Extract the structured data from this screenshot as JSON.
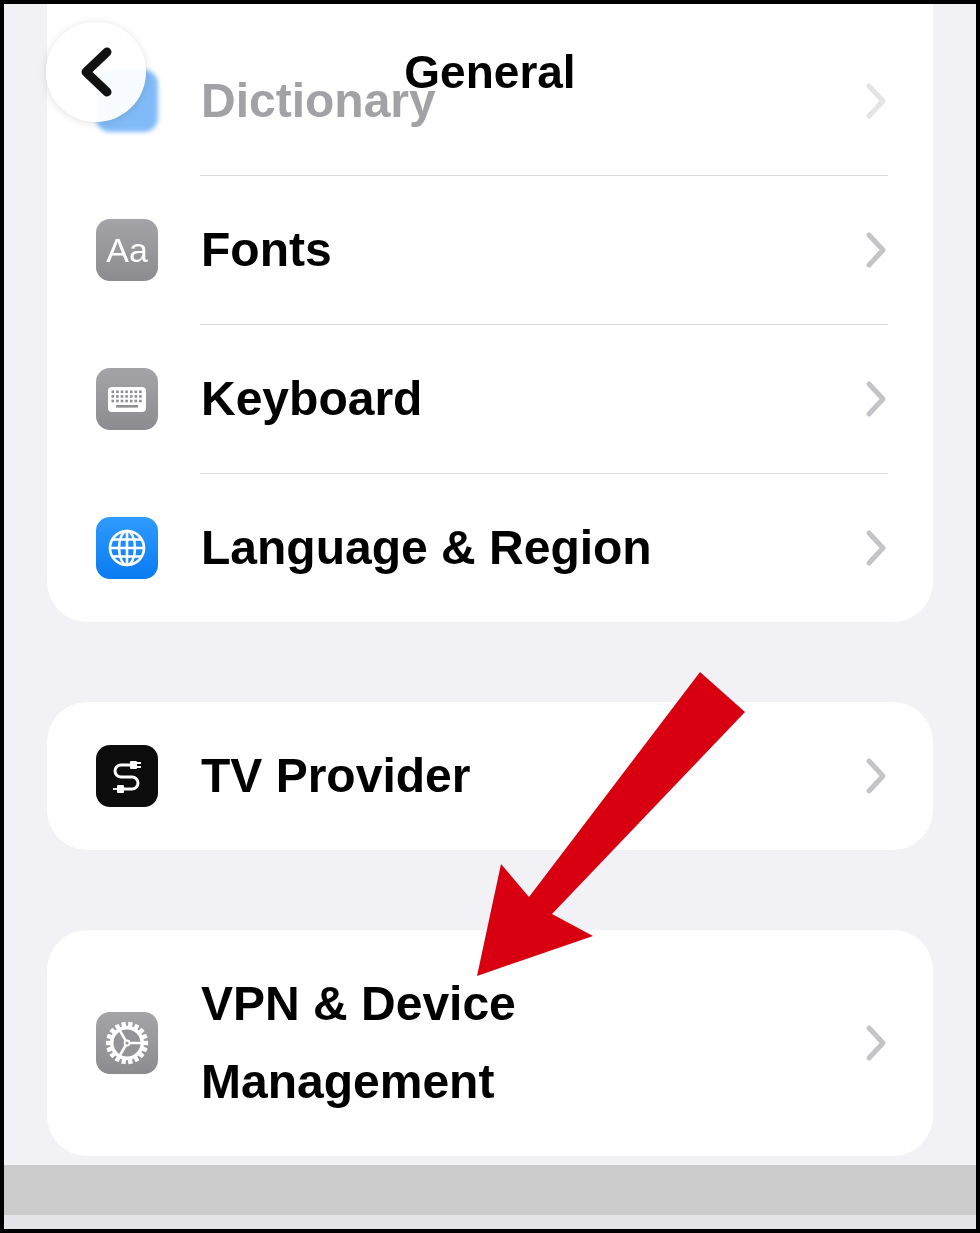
{
  "header": {
    "title": "General"
  },
  "groups": [
    {
      "rows": [
        {
          "label": "Dictionary",
          "faded": true,
          "pointed_at": false
        },
        {
          "label": "Fonts",
          "icon_text": "Aa",
          "faded": false,
          "pointed_at": false
        },
        {
          "label": "Keyboard",
          "faded": false,
          "pointed_at": false
        },
        {
          "label": "Language & Region",
          "faded": false,
          "pointed_at": false
        }
      ]
    },
    {
      "rows": [
        {
          "label": "TV Provider",
          "faded": false,
          "pointed_at": false
        }
      ]
    },
    {
      "rows": [
        {
          "label": "VPN & Device Management",
          "faded": false,
          "pointed_at": true
        }
      ]
    }
  ]
}
